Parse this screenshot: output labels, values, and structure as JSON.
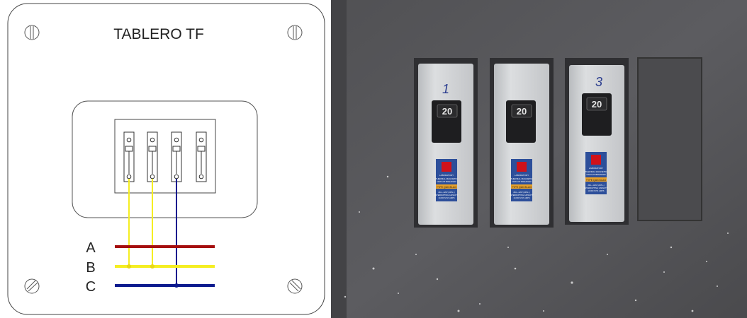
{
  "diagram": {
    "title": "TABLERO TF",
    "phases": [
      {
        "label": "A",
        "color": "#a50d0d"
      },
      {
        "label": "B",
        "color": "#f5ee22"
      },
      {
        "label": "C",
        "color": "#0d1a8e"
      }
    ],
    "breaker_count": 4
  },
  "photo": {
    "breakers": [
      {
        "number": "1",
        "rating": "20",
        "brand": "LABORATORY",
        "line1": "THERMAL MAGNETIC",
        "line2": "CIRCUIT BREAKER",
        "type": "TYPE QUICKLAG",
        "spec1": "20A—120V (240V~)",
        "spec2": "INTERRUPTING CAPACITY",
        "spec3": "10,000 SYM. AMPS"
      },
      {
        "number": "2",
        "rating": "20",
        "brand": "LABORATORY",
        "line1": "THERMAL MAGNETIC",
        "line2": "CIRCUIT BREAKER",
        "type": "TYPE QUICKLAG",
        "spec1": "20A—120V (240V~)",
        "spec2": "INTERRUPTING CAPACITY",
        "spec3": "10,000 SYM. AMPS"
      },
      {
        "number": "3",
        "rating": "20",
        "brand": "LABORATORY",
        "line1": "THERMAL MAGNETIC",
        "line2": "CIRCUIT BREAKER",
        "type": "TYPE QUICKLAG",
        "spec1": "20A—120V (240V~)",
        "spec2": "INTERRUPTING CAPACITY",
        "spec3": "10,000 SYM. AMPS"
      }
    ],
    "colors": {
      "panel": "#5b5b5d",
      "breaker": "#cfd1d3",
      "label": "#2d4f9a",
      "led": "#d0121a",
      "type_strip": "#e8a12a"
    }
  }
}
